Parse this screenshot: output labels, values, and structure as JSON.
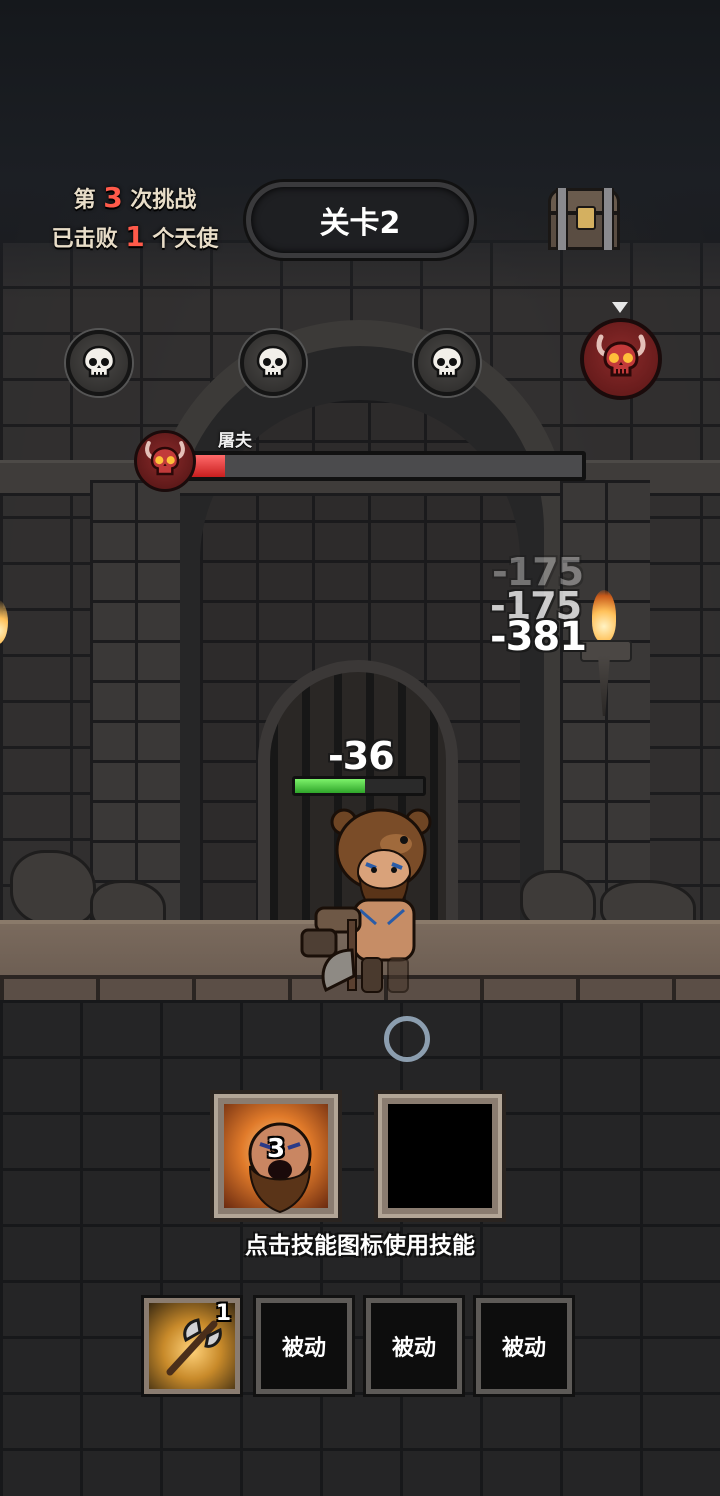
{
  "hud": {
    "challenge_prefix": "第",
    "challenge_count": "3",
    "challenge_suffix": "次挑战",
    "defeated_prefix": "已击败",
    "defeated_count": "1",
    "defeated_suffix": "个天使",
    "stage_title": "关卡2"
  },
  "enemy_track": {
    "nodes": [
      "skull-icon",
      "skull-icon",
      "skull-icon",
      "demon-skull-icon"
    ],
    "current_index": 3
  },
  "boss": {
    "name": "屠夫",
    "hp_fraction": 0.09,
    "hp_color": "#d62a2a"
  },
  "damage_numbers": [
    "-175",
    "-175",
    "-381"
  ],
  "hero": {
    "damage_taken": "-36",
    "hp_fraction": 0.55,
    "hp_color": "#3fbf35"
  },
  "active_skills": [
    {
      "icon": "berserker-portrait-icon",
      "count": "3"
    },
    {
      "icon": "empty-slot",
      "count": ""
    }
  ],
  "hint_text": "点击技能图标使用技能",
  "passive_skills": [
    {
      "icon": "battle-axe-icon",
      "level": "1",
      "label": ""
    },
    {
      "label": "被动"
    },
    {
      "label": "被动"
    },
    {
      "label": "被动"
    }
  ]
}
